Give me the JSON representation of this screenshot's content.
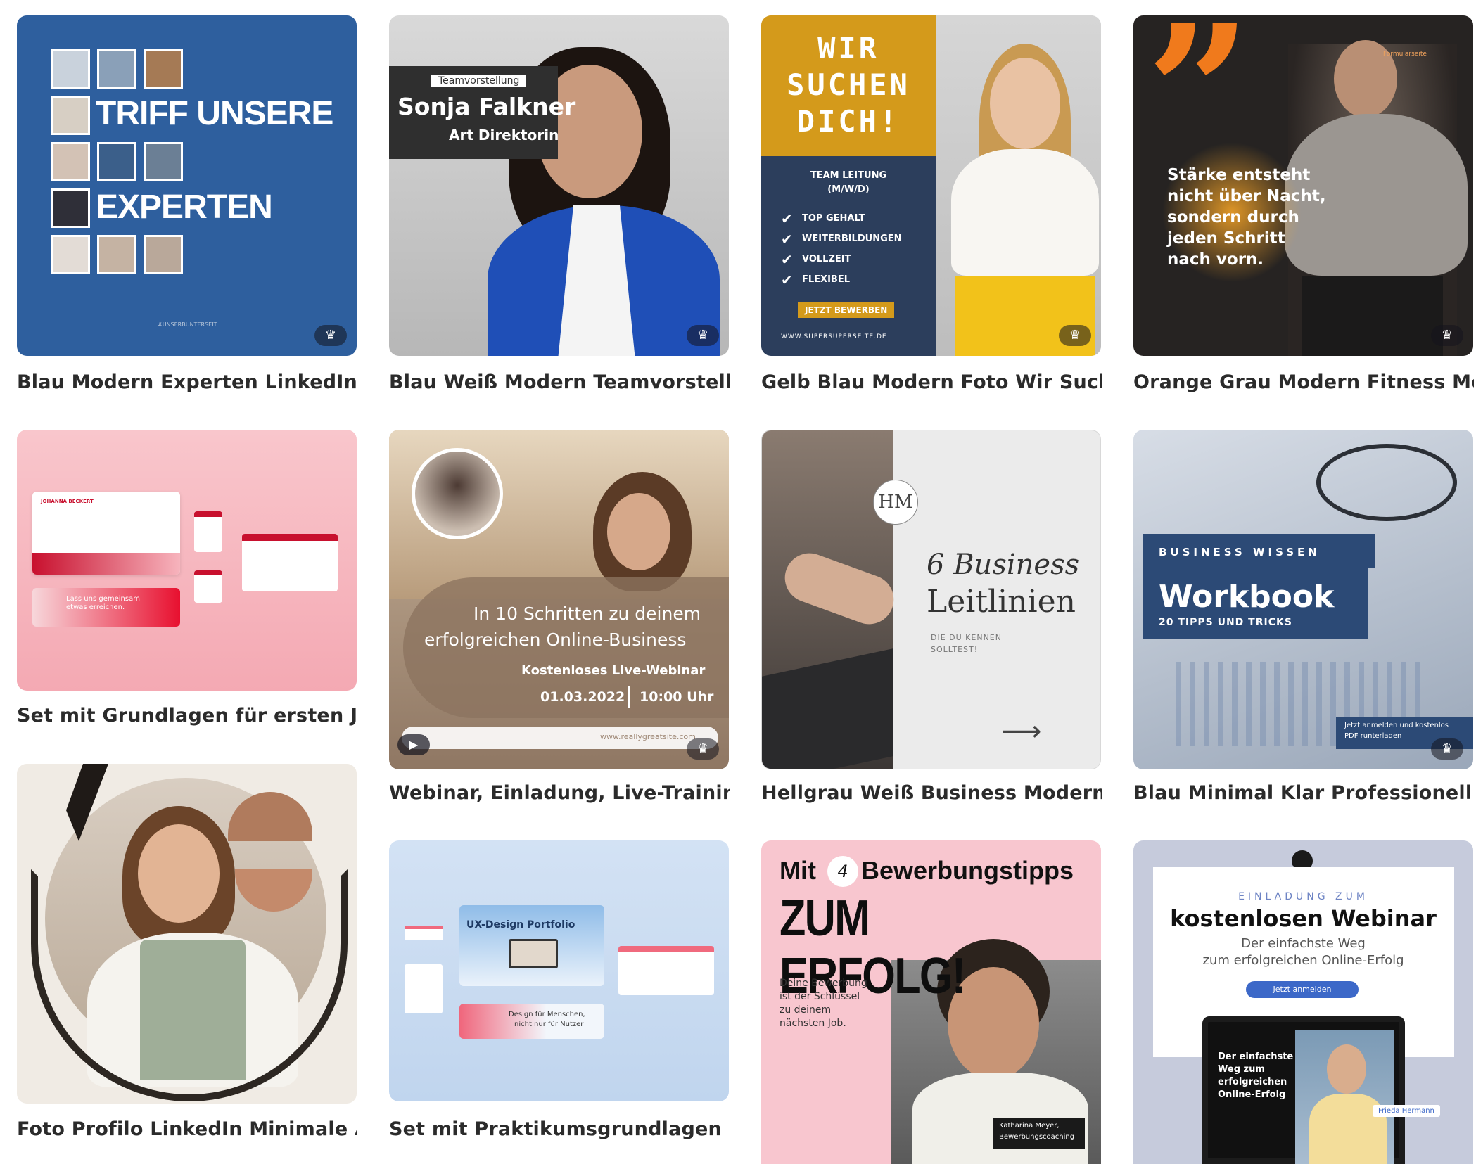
{
  "templates": [
    {
      "caption": "Blau Modern Experten LinkedIn Bei...",
      "lines": [
        "TRIFF UNSERE",
        "EXPERTEN"
      ],
      "footer": "#UNSERBUNTERSEIT"
    },
    {
      "caption": "Blau Weiß Modern Teamvorstellung...",
      "badge": "Teamvorstellung",
      "name": "Sonja Falkner",
      "role": "Art Direktorin"
    },
    {
      "caption": "Gelb Blau Modern Foto Wir Suchen ...",
      "headline": [
        "WIR",
        "SUCHEN",
        "DICH!"
      ],
      "job": [
        "TEAM LEITUNG",
        "(M/W/D)"
      ],
      "perks": [
        "TOP GEHALT",
        "WEITERBILDUNGEN",
        "VOLLZEIT",
        "FLEXIBEL"
      ],
      "cta": "JETZT BEWERBEN",
      "url": "WWW.SUPERSUPERSEITE.DE"
    },
    {
      "caption": "Orange Grau Modern Fitness Motiv...",
      "quote": [
        "Stärke entsteht",
        "nicht über Nacht,",
        "sondern durch",
        "jeden Schritt",
        "nach vorn."
      ],
      "tag": "Formularseite"
    },
    {
      "caption": "Set mit Grundlagen für ersten Job",
      "card_title": "JOHANNA BECKERT",
      "card_sub": "Lass uns gemeinsam etwas erreichen."
    },
    {
      "caption": "Webinar, Einladung, Live-Training, L...",
      "headline": [
        "In 10 Schritten zu deinem",
        "erfolgreichen Online-Business"
      ],
      "label": "Kostenloses Live-Webinar",
      "date": "01.03.2022",
      "time": "10:00 Uhr",
      "url": "www.reallygreatsite.com"
    },
    {
      "caption": "Hellgrau Weiß Business Modern Kar...",
      "logo": "HM",
      "title": [
        "6 Business",
        "Leitlinien"
      ],
      "sub": [
        "DIE DU KENNEN",
        "SOLLTEST!"
      ]
    },
    {
      "caption": "Blau Minimal Klar Professionell Lin...",
      "eyebrow": "BUSINESS WISSEN",
      "title": "Workbook",
      "sub": "20 TIPPS UND TRICKS",
      "note": [
        "Jetzt anmelden und kostenlos",
        "PDF runterladen"
      ]
    },
    {
      "caption": "Foto Profilo LinkedIn Minimale Acc..."
    },
    {
      "caption": "Set mit Praktikumsgrundlagen",
      "portfolio_title": "UX-Design Portfolio",
      "tagline": [
        "Design für Menschen,",
        "nicht nur für Nutzer"
      ]
    },
    {
      "caption": "",
      "title_top": "Bewerbungstipps",
      "title_mit": "Mit",
      "number": "4",
      "title_big": "ZUM ERFOLG!",
      "body": [
        "Deine Bewerbung",
        "ist der Schlüssel",
        "zu deinem",
        "nächsten Job."
      ],
      "name_tag": [
        "Katharina Meyer,",
        "Bewerbungscoaching"
      ]
    },
    {
      "caption": "",
      "eyebrow": "EINLADUNG ZUM",
      "title": "kostenlosen Webinar",
      "sub": [
        "Der einfachste Weg",
        "zum erfolgreichen Online-Erfolg"
      ],
      "button": "Jetzt anmelden",
      "screen_text": [
        "Der einfachste",
        "Weg zum",
        "erfolgreichen",
        "Online-Erfolg"
      ],
      "presenter": "Frieda Hermann"
    }
  ],
  "icons": {
    "premium": "crown-icon",
    "play": "play-icon",
    "check": "check-icon",
    "arrow": "arrow-right-icon"
  },
  "colors": {
    "blue_brand": "#2e5f9e",
    "yellow": "#d49a1b",
    "navy": "#2c3e5c",
    "orange": "#f07a1c",
    "pink": "#f7b4bd",
    "caption": "#2b2b2b"
  }
}
